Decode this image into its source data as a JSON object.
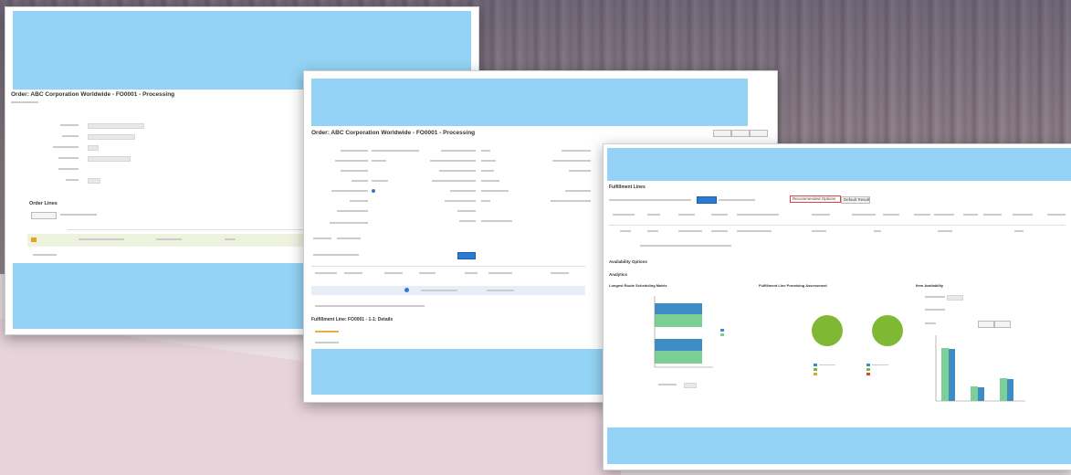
{
  "colors": {
    "band": "#94d3f5",
    "accent_blue": "#2a7bd3",
    "bar_blue": "#3f8cc4",
    "bar_green": "#7ccf95",
    "pie_green": "#7fb832",
    "highlight_red": "#e04040"
  },
  "shot1": {
    "title": "Order: ABC Corporation Worldwide - FO0001 - Processing",
    "section": "Order Lines"
  },
  "shot2": {
    "title": "Order: ABC Corporation Worldwide - FO0001 - Processing",
    "section": "Fulfillment Line: FO0001 - 1-1: Details"
  },
  "shot3": {
    "title": "Fulfillment Lines",
    "highlighted_button": "Recommended Options",
    "button_next": "Default Result",
    "section1": "Availability Options",
    "section2": "Analytics",
    "chart_left_title": "Longest Route Scheduling Matrix",
    "chart_mid_title": "Fulfillment Line Promising Assessment",
    "chart_right_title": "Item Availability"
  },
  "chart_data": [
    {
      "type": "bar",
      "orientation": "horizontal",
      "series": [
        {
          "name": "",
          "values": [
            2,
            2
          ]
        },
        {
          "name": "",
          "values": [
            2,
            2
          ]
        }
      ]
    },
    {
      "type": "pie",
      "values": [
        100,
        100
      ]
    },
    {
      "type": "bar",
      "series": [
        {
          "name": "",
          "values": [
            80,
            22,
            35
          ]
        },
        {
          "name": "",
          "values": [
            78,
            20,
            33
          ]
        }
      ]
    }
  ]
}
